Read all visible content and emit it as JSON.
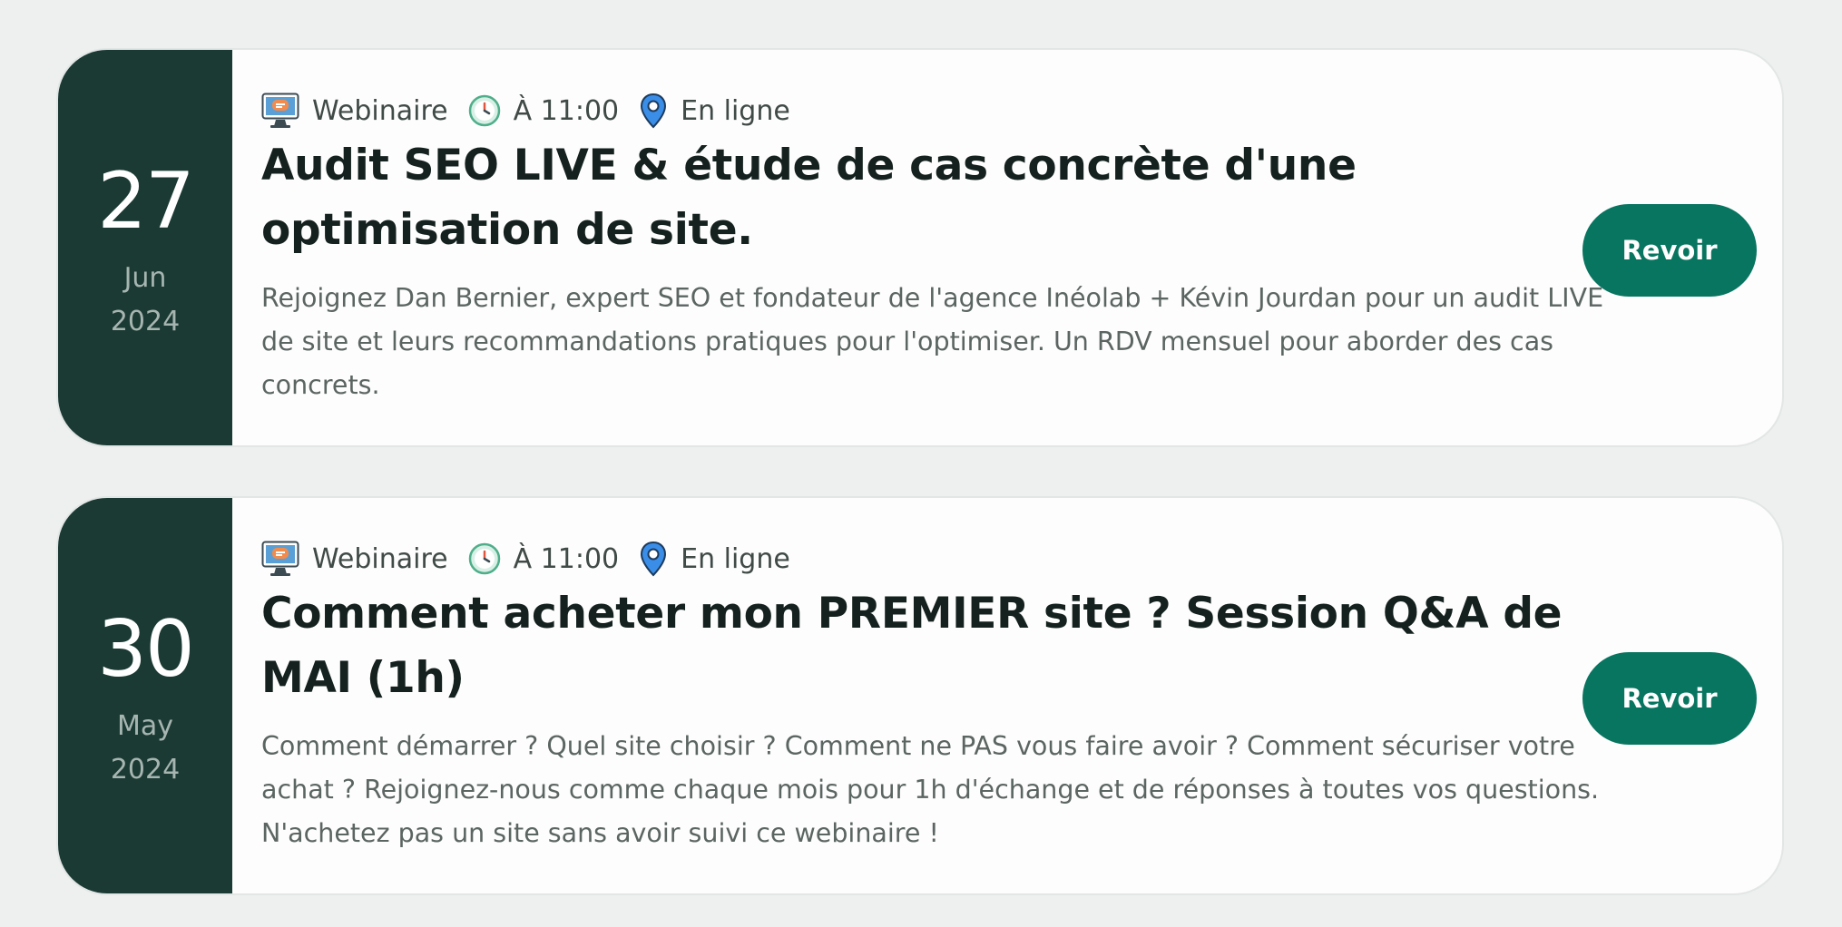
{
  "events": [
    {
      "date": {
        "day": "27",
        "month": "Jun",
        "year": "2024"
      },
      "meta": {
        "type": "Webinaire",
        "time": "À 11:00",
        "location": "En ligne"
      },
      "title": "Audit SEO LIVE & étude de cas concrète d'une optimisation de site.",
      "description": "Rejoignez Dan Bernier, expert SEO et fondateur de l'agence Inéolab + Kévin Jourdan pour un audit LIVE de site et leurs recommandations pratiques pour l'optimiser. Un RDV mensuel pour aborder des cas concrets.",
      "button_label": "Revoir"
    },
    {
      "date": {
        "day": "30",
        "month": "May",
        "year": "2024"
      },
      "meta": {
        "type": "Webinaire",
        "time": "À 11:00",
        "location": "En ligne"
      },
      "title": "Comment acheter mon PREMIER site ? Session Q&A de MAI (1h)",
      "description": "Comment démarrer ? Quel site choisir ? Comment ne PAS vous faire avoir ? Comment sécuriser votre achat ? Rejoignez-nous comme chaque mois pour 1h d'échange et de réponses à toutes vos questions. N'achetez pas un site sans avoir suivi ce webinaire !",
      "button_label": "Revoir"
    }
  ],
  "icons": {
    "type": "monitor-icon",
    "time": "clock-icon",
    "location": "map-pin-icon"
  },
  "colors": {
    "date_block": "#1b3a33",
    "button": "#087560",
    "page_background": "#edf0ef",
    "card_background": "#fdfdfd"
  }
}
